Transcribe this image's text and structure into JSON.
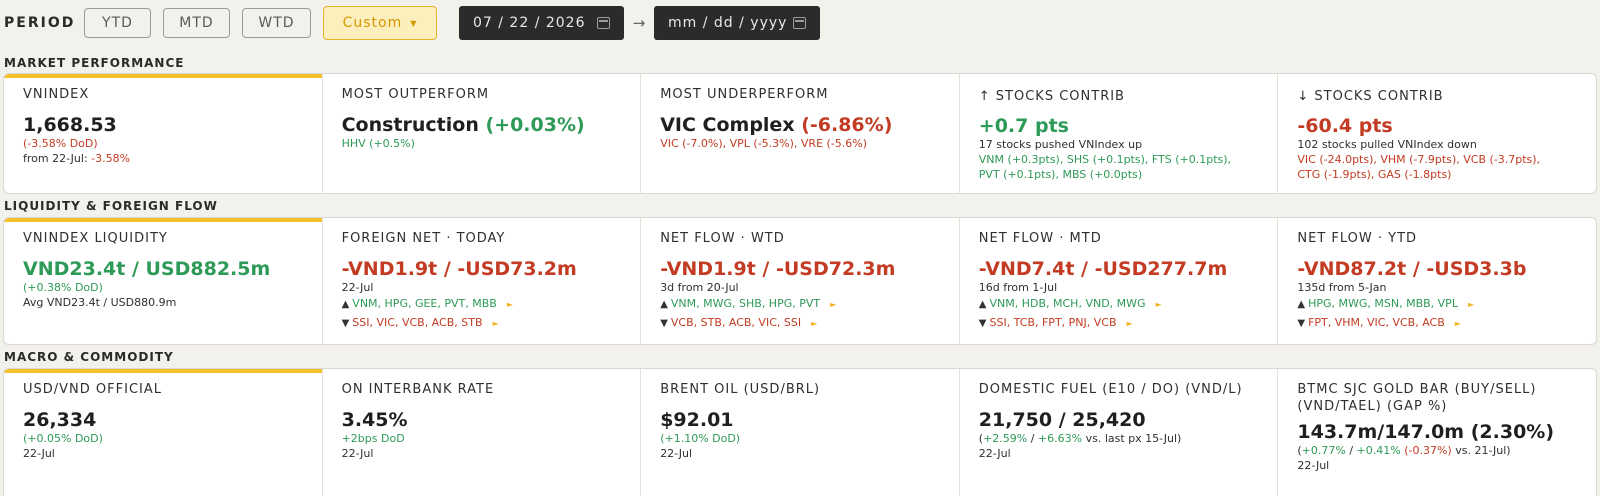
{
  "period": {
    "label": "PERIOD",
    "buttons": [
      "YTD",
      "MTD",
      "WTD"
    ],
    "custom_label": "Custom",
    "start_date": "07 / 22 / 2026",
    "end_placeholder": "mm / dd / yyyy",
    "arrow": "→"
  },
  "sections": {
    "market": "MARKET PERFORMANCE",
    "liquidity": "LIQUIDITY & FOREIGN FLOW",
    "macro": "MACRO & COMMODITY"
  },
  "market": {
    "vnindex": {
      "title": "VNINDEX",
      "value": "1,668.53",
      "dod": "(-3.58% DoD)",
      "from_prefix": "from 22-Jul: ",
      "from_value": "-3.58%"
    },
    "outperform": {
      "title": "MOST OUTPERFORM",
      "name": "Construction",
      "change": "(+0.03%)",
      "detail": "HHV (+0.5%)"
    },
    "underperform": {
      "title": "MOST UNDERPERFORM",
      "name": "VIC Complex",
      "change": "(-6.86%)",
      "detail": "VIC (-7.0%), VPL (-5.3%), VRE (-5.6%)"
    },
    "up_contrib": {
      "title": "↑ STOCKS CONTRIB",
      "value": "+0.7 pts",
      "desc": "17 stocks pushed VNIndex up",
      "line1": "VNM (+0.3pts), SHS (+0.1pts), FTS (+0.1pts),",
      "line2": "PVT (+0.1pts), MBS (+0.0pts)"
    },
    "down_contrib": {
      "title": "↓ STOCKS CONTRIB",
      "value": "-60.4 pts",
      "desc": "102 stocks pulled VNIndex down",
      "line1": "VIC (-24.0pts), VHM (-7.9pts), VCB (-3.7pts),",
      "line2": "CTG (-1.9pts), GAS (-1.8pts)"
    }
  },
  "liquidity": {
    "vnliq": {
      "title": "VNINDEX LIQUIDITY",
      "value": "VND23.4t / USD882.5m",
      "change": "(+0.38% DoD)",
      "avg": "Avg VND23.4t / USD880.9m"
    },
    "foreign": {
      "title": "FOREIGN NET · TODAY",
      "value": "-VND1.9t / -USD73.2m",
      "sub": "22-Jul",
      "up": "VNM, HPG, GEE, PVT, MBB",
      "down": "SSI, VIC, VCB, ACB, STB"
    },
    "wtd": {
      "title": "NET FLOW · WTD",
      "value": "-VND1.9t / -USD72.3m",
      "sub": "3d from 20-Jul",
      "up": "VNM, MWG, SHB, HPG, PVT",
      "down": "VCB, STB, ACB, VIC, SSI"
    },
    "mtd": {
      "title": "NET FLOW · MTD",
      "value": "-VND7.4t / -USD277.7m",
      "sub": "16d from 1-Jul",
      "up": "VNM, HDB, MCH, VND, MWG",
      "down": "SSI, TCB, FPT, PNJ, VCB"
    },
    "ytd": {
      "title": "NET FLOW · YTD",
      "value": "-VND87.2t / -USD3.3b",
      "sub": "135d from 5-Jan",
      "up": "HPG, MWG, MSN, MBB, VPL",
      "down": "FPT, VHM, VIC, VCB, ACB"
    },
    "up_glyph": "▲",
    "down_glyph": "▼",
    "more_glyph": "►"
  },
  "macro": {
    "usdvnd": {
      "title": "USD/VND OFFICIAL",
      "value": "26,334",
      "change": "(+0.05% DoD)",
      "date": "22-Jul"
    },
    "interbank": {
      "title": "ON INTERBANK RATE",
      "value": "3.45%",
      "change": "+2bps DoD",
      "date": "22-Jul"
    },
    "brent": {
      "title": "BRENT OIL (USD/BRL)",
      "value": "$92.01",
      "change": "(+1.10% DoD)",
      "date": "22-Jul"
    },
    "fuel": {
      "title": "DOMESTIC FUEL (E10 / DO) (VND/L)",
      "value": "21,750 / 25,420",
      "open": "(",
      "c1": "+2.59%",
      "sep": " / ",
      "c2": "+6.63%",
      "tail": " vs. last px 15-Jul)",
      "date": "22-Jul"
    },
    "gold": {
      "title_line1": "BTMC SJC GOLD BAR (BUY/SELL)",
      "title_line2": "(VND/TAEL) (GAP %)",
      "value": "143.7m/147.0m (2.30%)",
      "open": "(",
      "c1": "+0.77%",
      "sep": " / ",
      "c2": "+0.41%",
      "c3": " (-0.37%)",
      "tail": " vs. 21-Jul)",
      "date": "22-Jul"
    }
  },
  "colors": {
    "accent": "#f3c12b",
    "positive": "#2e9a58",
    "negative": "#c23b22",
    "custom_bg": "#fdefbd",
    "date_bg": "#2b2b2b"
  }
}
